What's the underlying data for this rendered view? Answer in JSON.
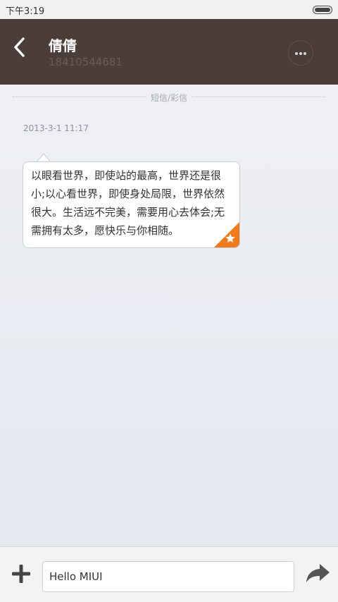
{
  "status_bar": {
    "time": "下午3:19"
  },
  "header": {
    "contact_name": "倩倩",
    "contact_number": "18410544681"
  },
  "thread": {
    "divider_label": "短信/彩信",
    "timestamp": "2013-3-1 11:17",
    "messages": [
      {
        "text": "以眼看世界，即使站的最高，世界还是很小;以心看世界，即使身处局限，世界依然很大。生活远不完美，需要用心去体会;无需拥有太多，愿快乐与你相随。",
        "favorited": true
      }
    ]
  },
  "composer": {
    "value": "Hello MIUI"
  },
  "colors": {
    "header_bg": "#4b3d3a",
    "favorite_accent": "#f07a1c"
  },
  "icons": [
    "back-icon",
    "more-icon",
    "star-icon",
    "add-icon",
    "send-icon",
    "battery-icon"
  ]
}
